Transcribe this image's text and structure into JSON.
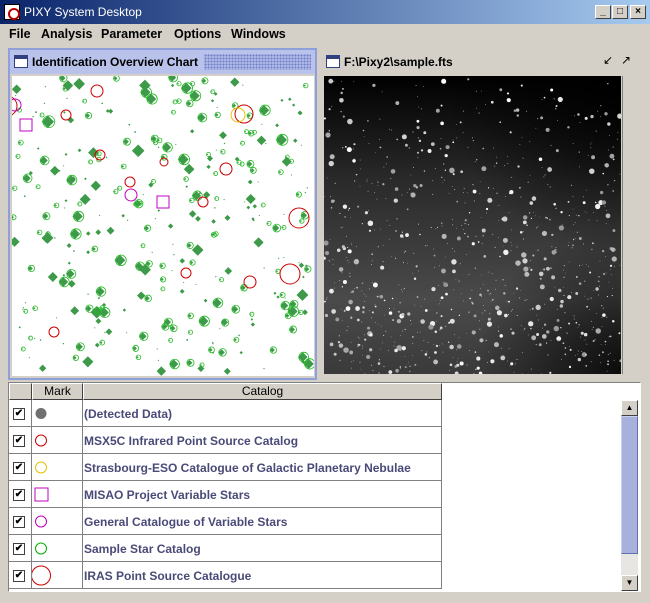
{
  "window": {
    "title": "PIXY System Desktop"
  },
  "menu": [
    {
      "label": "File"
    },
    {
      "label": "Analysis"
    },
    {
      "label": "Parameter"
    },
    {
      "label": "Options"
    },
    {
      "label": "Windows"
    }
  ],
  "chart_frame": {
    "title": "Identification Overview Chart"
  },
  "image_frame": {
    "title": "F:\\Pixy2\\sample.fts"
  },
  "table": {
    "columns": [
      "",
      "Mark",
      "Catalog"
    ],
    "rows": [
      {
        "checked": true,
        "mark": "filled-circle",
        "color": "#707070",
        "catalog": "(Detected Data)"
      },
      {
        "checked": true,
        "mark": "circle",
        "color": "#cc0000",
        "catalog": "MSX5C Infrared Point Source Catalog"
      },
      {
        "checked": true,
        "mark": "circle",
        "color": "#e8c000",
        "catalog": "Strasbourg-ESO Catalogue of Galactic Planetary Nebulae"
      },
      {
        "checked": true,
        "mark": "square",
        "color": "#c000c0",
        "catalog": "MISAO Project Variable Stars"
      },
      {
        "checked": true,
        "mark": "circle",
        "color": "#c000c0",
        "catalog": "General Catalogue of Variable Stars"
      },
      {
        "checked": true,
        "mark": "circle",
        "color": "#00b000",
        "catalog": "Sample Star Catalog"
      },
      {
        "checked": true,
        "mark": "large-circle",
        "color": "#cc0000",
        "catalog": "IRAS Point Source Catalogue"
      }
    ]
  },
  "icons": {
    "minimize": "minimize-icon",
    "maximize": "maximize-icon",
    "close": "close-icon",
    "check": "✔",
    "restore": "↙",
    "expand": "↗",
    "scroll_up": "▲",
    "scroll_down": "▼"
  }
}
